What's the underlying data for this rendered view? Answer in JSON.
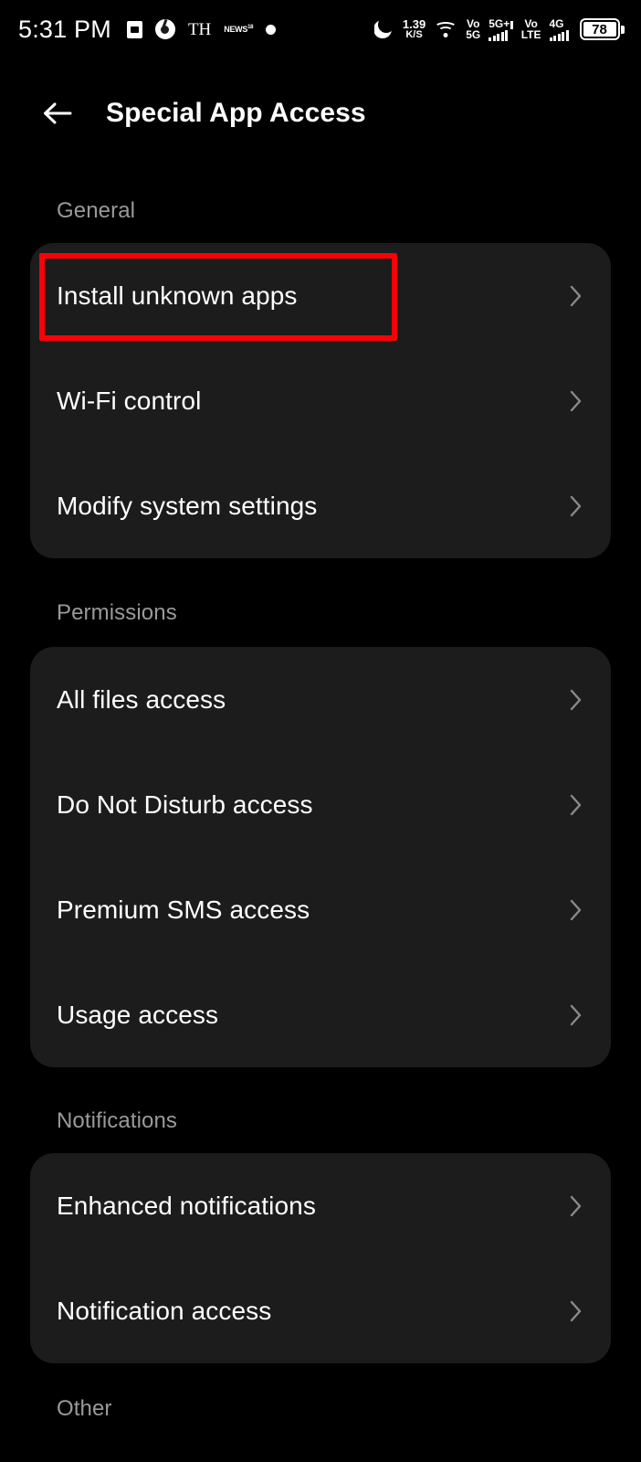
{
  "status_bar": {
    "clock": "5:31 PM",
    "notification_icons": [
      {
        "name": "calculator-icon",
        "glyph": "box"
      },
      {
        "name": "chrome-icon",
        "glyph": "chrome"
      },
      {
        "name": "th-app-icon",
        "glyph": "TH"
      },
      {
        "name": "news-app-icon",
        "glyph": "news"
      },
      {
        "name": "generic-notification-dot-icon",
        "glyph": "dot"
      }
    ],
    "dnd_icon": "moon-icon",
    "network_speed": {
      "value": "1.39",
      "unit": "K/S"
    },
    "wifi_icon": "wifi-icon",
    "sim1": {
      "volte_top": "Vo",
      "volte_bottom": "5G",
      "network": "5G+",
      "signal_bars": 5
    },
    "sim2": {
      "volte_top": "Vo",
      "volte_bottom": "LTE",
      "network": "4G",
      "signal_bars": 5
    },
    "battery": {
      "percent": "78"
    }
  },
  "app_bar": {
    "back_icon": "back-arrow-icon",
    "title": "Special App Access"
  },
  "colors": {
    "background": "#000000",
    "card": "#1c1c1c",
    "primary_text": "#ffffff",
    "section_header_text": "#9a9a9a",
    "chevron": "#8a8a8a",
    "highlight_border": "#fb0007"
  },
  "sections": [
    {
      "header": "General",
      "items": [
        {
          "label": "Install unknown apps",
          "chevron": "chevron-right-icon",
          "highlighted": true
        },
        {
          "label": "Wi-Fi control",
          "chevron": "chevron-right-icon",
          "highlighted": false
        },
        {
          "label": "Modify system settings",
          "chevron": "chevron-right-icon",
          "highlighted": false
        }
      ]
    },
    {
      "header": "Permissions",
      "items": [
        {
          "label": "All files access",
          "chevron": "chevron-right-icon",
          "highlighted": false
        },
        {
          "label": "Do Not Disturb access",
          "chevron": "chevron-right-icon",
          "highlighted": false
        },
        {
          "label": "Premium SMS access",
          "chevron": "chevron-right-icon",
          "highlighted": false
        },
        {
          "label": "Usage access",
          "chevron": "chevron-right-icon",
          "highlighted": false
        }
      ]
    },
    {
      "header": "Notifications",
      "items": [
        {
          "label": "Enhanced notifications",
          "chevron": "chevron-right-icon",
          "highlighted": false
        },
        {
          "label": "Notification access",
          "chevron": "chevron-right-icon",
          "highlighted": false
        }
      ]
    },
    {
      "header": "Other",
      "items": []
    }
  ]
}
